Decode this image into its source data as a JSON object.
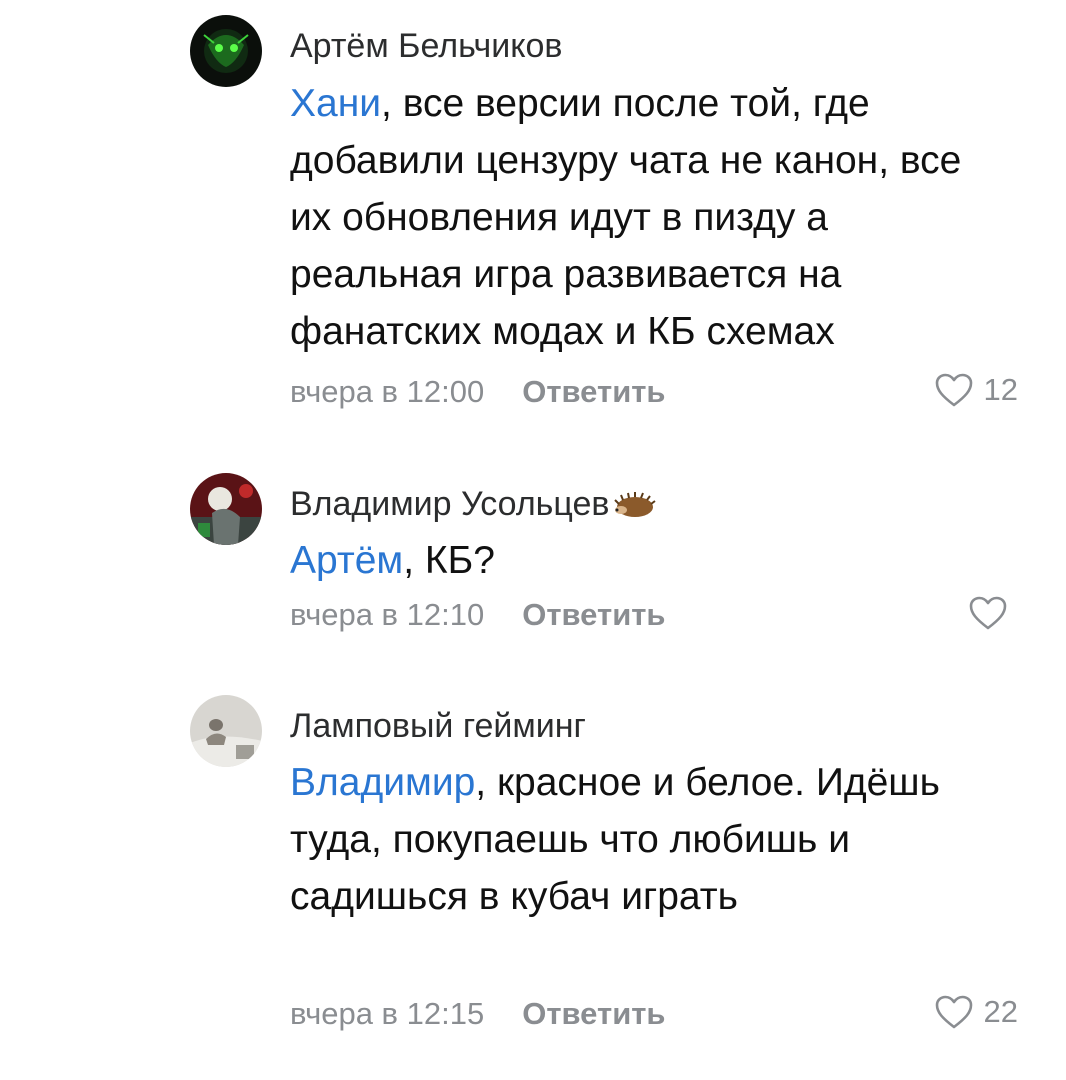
{
  "comments": [
    {
      "author": "Артём Бельчиков",
      "mention": "Хани",
      "text": ", все версии после той, где добавили цензуру чата не канон, все их обновления идут в пизду а реальная игра развивается на фанатских модах и КБ схемах",
      "time": "вчера в 12:00",
      "reply_label": "Ответить",
      "likes": "12",
      "avatar_icon": "dark-green-avatar"
    },
    {
      "author": "Владимир Усольцев",
      "author_emoji": "hedgehog-icon",
      "mention": "Артём",
      "text": ", КБ?",
      "time": "вчера в 12:10",
      "reply_label": "Ответить",
      "likes": "",
      "avatar_icon": "red-illustration-avatar"
    },
    {
      "author": "Ламповый гейминг",
      "mention": "Владимир",
      "text": ", красное и белое. Идёшь туда, покупаешь что любишь и садишься в кубач играть",
      "time": "вчера в 12:15",
      "reply_label": "Ответить",
      "likes": "22",
      "avatar_icon": "light-photo-avatar"
    }
  ],
  "colors": {
    "mention": "#2a76d2",
    "meta": "#8a8d91",
    "author": "#2c2d2e"
  }
}
